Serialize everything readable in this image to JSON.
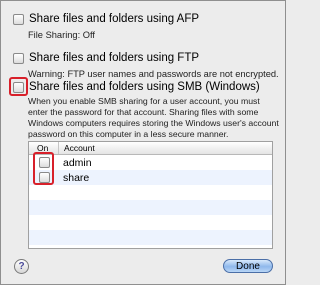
{
  "options": {
    "afp": {
      "label": "Share files and folders using AFP",
      "status": "File Sharing: Off"
    },
    "ftp": {
      "label": "Share files and folders using FTP",
      "warning": "Warning: FTP user names and passwords are not encrypted."
    },
    "smb": {
      "label": "Share files and folders using SMB (Windows)",
      "description": "When you enable SMB sharing for a user account, you must enter the password for that account. Sharing files with some Windows computers requires storing the Windows user's account password on this computer in a less secure manner."
    }
  },
  "accounts_table": {
    "columns": [
      "On",
      "Account"
    ],
    "rows": [
      {
        "on": false,
        "account": "admin"
      },
      {
        "on": false,
        "account": "share"
      }
    ]
  },
  "footer": {
    "help_symbol": "?",
    "done_label": "Done"
  },
  "colors": {
    "highlight": "#d8202a",
    "row_alt": "#edf3fe",
    "done_button": "#8fb8ec"
  }
}
